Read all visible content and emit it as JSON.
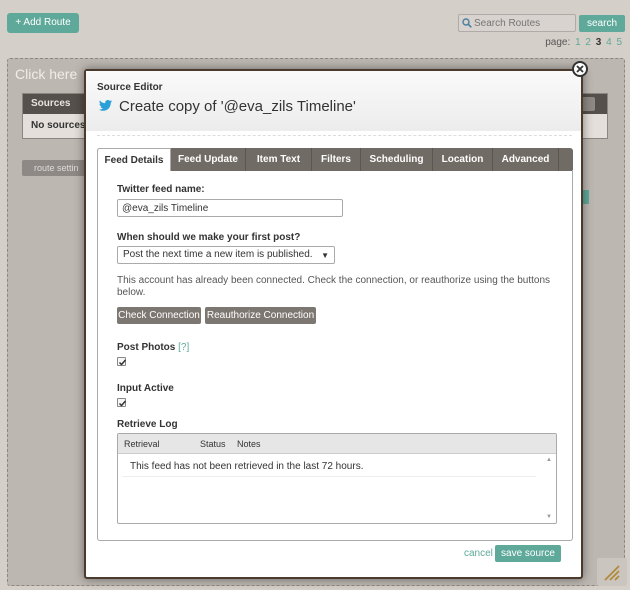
{
  "background": {
    "add_route_label": "+ Add Route",
    "search": {
      "placeholder": "Search Routes",
      "button_label": "search"
    },
    "pagination": {
      "label": "page:",
      "pages": [
        "1",
        "2",
        "3",
        "4",
        "5"
      ],
      "current": "3"
    },
    "click_here_text": "Click here",
    "sources_header": "Sources",
    "no_sources_text": "No sources",
    "route_settings_label": "route settin"
  },
  "modal": {
    "title_small": "Source Editor",
    "title": "Create copy of '@eva_zils Timeline'",
    "tabs": [
      {
        "label": "Feed Details",
        "active": true
      },
      {
        "label": "Feed Update",
        "active": false
      },
      {
        "label": "Item Text",
        "active": false
      },
      {
        "label": "Filters",
        "active": false
      },
      {
        "label": "Scheduling",
        "active": false
      },
      {
        "label": "Location",
        "active": false
      },
      {
        "label": "Advanced",
        "active": false
      }
    ],
    "feed_name": {
      "label": "Twitter feed name:",
      "value": "@eva_zils Timeline"
    },
    "first_post": {
      "label": "When should we make your first post?",
      "selected": "Post the next time a new item is published."
    },
    "info_text": "This account has already been connected. Check the connection, or reauthorize using the buttons below.",
    "check_connection_label": "Check Connection",
    "reauthorize_label": "Reauthorize Connection",
    "post_photos": {
      "label": "Post Photos",
      "help": "[?]",
      "checked": true
    },
    "input_active": {
      "label": "Input Active",
      "checked": true
    },
    "retrieve_log": {
      "label": "Retrieve Log",
      "columns": [
        "Retrieval",
        "Status",
        "Notes"
      ],
      "message": "This feed has not been retrieved in the last 72 hours."
    },
    "cancel_label": "cancel",
    "save_label": "save source"
  },
  "colors": {
    "accent": "#5fa99a",
    "tab_bar": "#716b65",
    "modal_border": "#4a3b2c",
    "gray_button": "#7d7772"
  },
  "icons": [
    "search-icon",
    "twitter-icon",
    "close-icon",
    "checkbox-check-icon",
    "chevron-down-icon",
    "resize-handle-icon"
  ]
}
